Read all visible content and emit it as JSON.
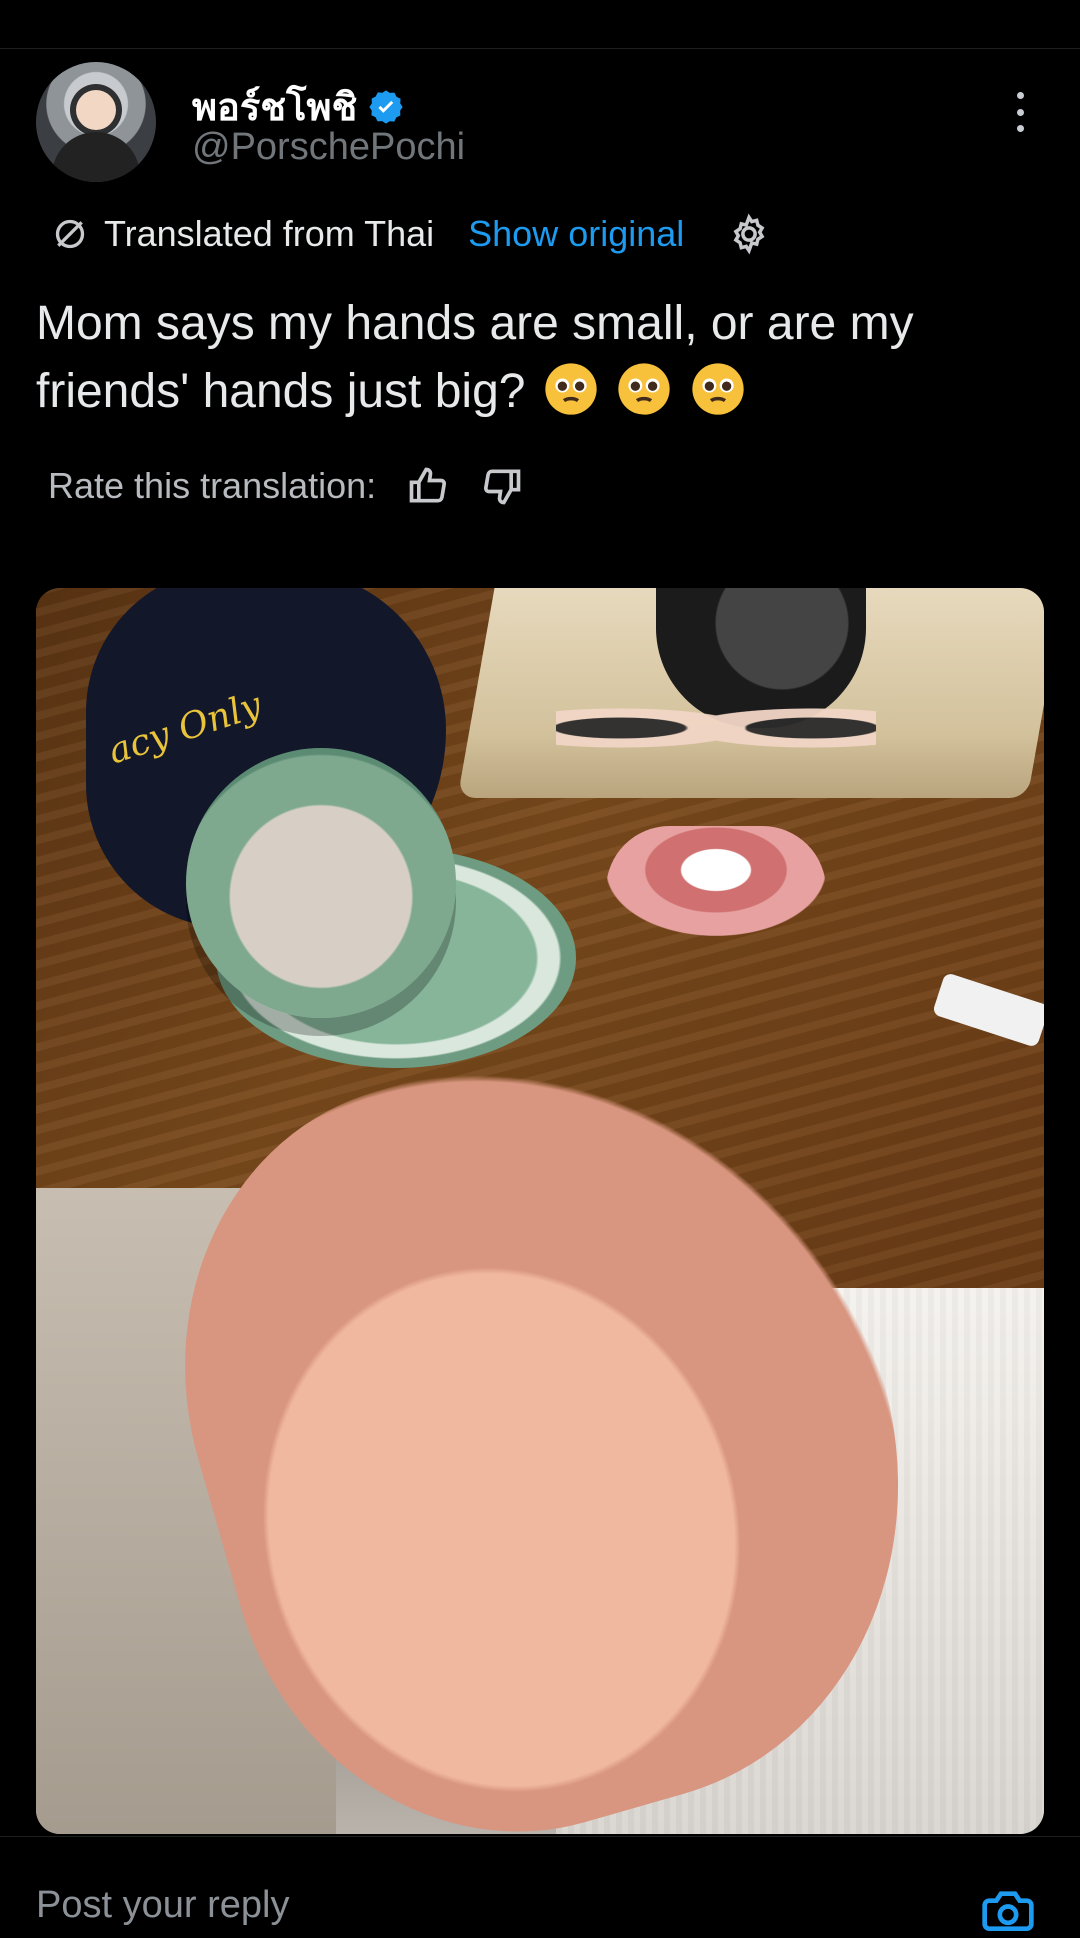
{
  "tweet": {
    "author": {
      "display_name": "พอร์ชโพชิ",
      "handle": "@PorschePochi",
      "verified": true
    },
    "translation": {
      "label": "Translated from Thai",
      "show_original": "Show original"
    },
    "text": "Mom says my hands are small, or are my friends' hands just big?",
    "rate_label": "Rate this translation:"
  },
  "media": {
    "cap_text": "acy Only"
  },
  "reply": {
    "placeholder": "Post your reply"
  },
  "colors": {
    "accent": "#1d9bf0",
    "background": "#000000",
    "text": "#e7e9ea",
    "muted": "#71767b"
  },
  "icons": {
    "verified": "verified-badge-icon",
    "translate": "translate-icon",
    "settings": "settings-gear-icon",
    "thumb_up": "thumb-up-icon",
    "thumb_down": "thumb-down-icon",
    "camera": "camera-icon",
    "more": "more-vertical-icon"
  }
}
